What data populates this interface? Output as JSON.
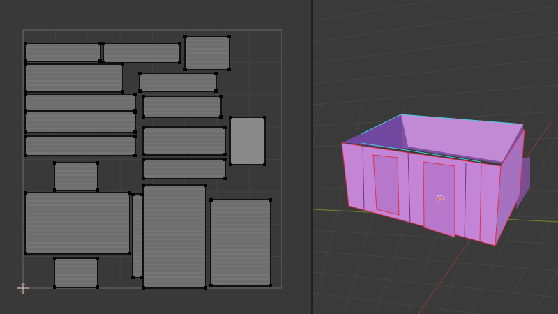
{
  "uv_editor": {
    "background_color": "#393939",
    "uv_bounds_color": "#6a6a6a",
    "island_fill": "#6e6e6e",
    "selected_island_fill": "#8a8a8a",
    "edge_color": "#e0e0e0",
    "cursor_icon": "2d-cursor-icon"
  },
  "viewport": {
    "background_color": "#3a3a3a",
    "grid_color": "#454545",
    "x_axis_color": "#8a3a44",
    "y_axis_color": "#6a8a2a",
    "mesh_face_color": "#c486d6",
    "mesh_dark_color": "#8a5aa6",
    "seam_color": "#e0304a",
    "sharp_edge_color": "#40d0e0",
    "origin_icon": "object-origin-icon"
  }
}
